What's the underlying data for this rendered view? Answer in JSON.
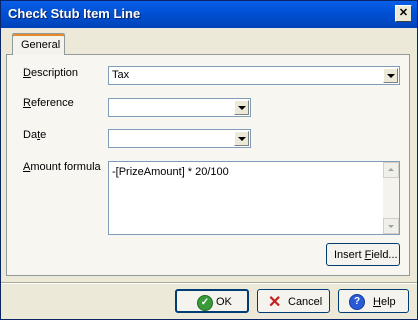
{
  "window": {
    "title": "Check Stub Item Line",
    "close_glyph": "✕"
  },
  "tabs": [
    {
      "label": "General"
    }
  ],
  "form": {
    "description": {
      "label_u": "D",
      "label_rest": "escription",
      "value": "Tax"
    },
    "reference": {
      "label_u": "R",
      "label_rest": "eference",
      "value": ""
    },
    "date": {
      "label_pre": "Da",
      "label_u": "t",
      "label_rest": "e",
      "value": ""
    },
    "amount_formula": {
      "label_pre": "",
      "label_u": "A",
      "label_rest": "mount formula",
      "value": "-[PrizeAmount] * 20/100"
    }
  },
  "buttons": {
    "insert_field": {
      "pre": "Insert ",
      "u": "F",
      "rest": "ield..."
    },
    "ok": {
      "label": "OK",
      "icon_glyph": "✓"
    },
    "cancel": {
      "label": "Cancel",
      "icon_glyph": "✕"
    },
    "help": {
      "u": "H",
      "rest": "elp",
      "icon_glyph": "?"
    }
  }
}
